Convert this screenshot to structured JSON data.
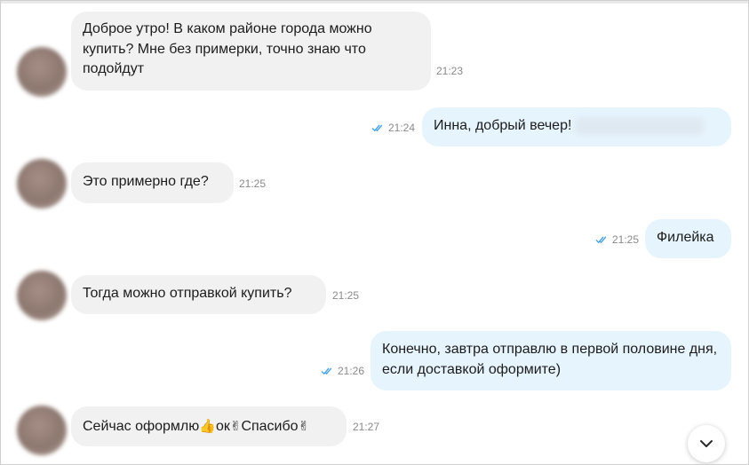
{
  "messages": [
    {
      "text": "Доброе утро! В каком районе города можно купить? Мне без примерки, точно знаю что подойдут",
      "time": "21:23"
    },
    {
      "text": "Инна, добрый вечер!",
      "time": "21:24"
    },
    {
      "text": "Это примерно где?",
      "time": "21:25"
    },
    {
      "text": "Филейка",
      "time": "21:25"
    },
    {
      "text": "Тогда можно отправкой купить?",
      "time": "21:25"
    },
    {
      "text": "Конечно, завтра отправлю в первой половине дня, если доставкой оформите)",
      "time": "21:26"
    },
    {
      "text_a": "Сейчас оформлю",
      "text_b": "ок",
      "text_c": "Спасибо",
      "time": "21:27"
    }
  ],
  "icons": {
    "read_ticks": "double-check-icon",
    "scroll_down": "chevron-down-icon",
    "thumbs_up": "👍",
    "victory_hand": "✌"
  },
  "colors": {
    "incoming_bubble": "#f1f1f1",
    "outgoing_bubble": "#e6f4fe",
    "ticks": "#4aa3e8"
  }
}
